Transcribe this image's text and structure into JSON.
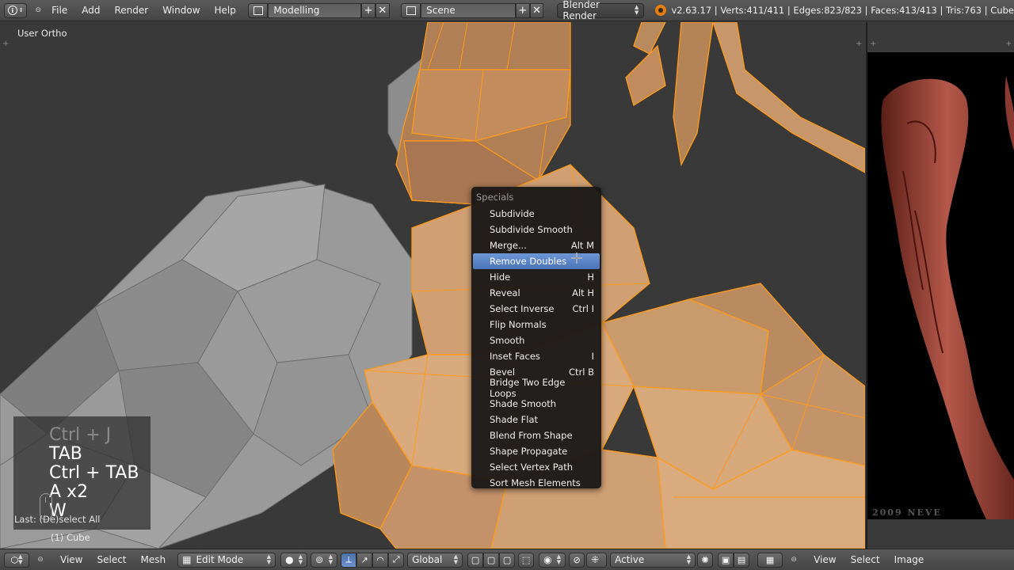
{
  "topbar": {
    "menus": [
      "File",
      "Add",
      "Render",
      "Window",
      "Help"
    ],
    "layout": "Modelling",
    "scene": "Scene",
    "engine": "Blender Render",
    "stats": "v2.63.17 | Verts:411/411 | Edges:823/823 | Faces:413/413 | Tris:763 | Cube"
  },
  "viewport": {
    "view_label": "User Ortho",
    "object_label": "(1) Cube",
    "last_op": "Last: (De)select All"
  },
  "key_overlay": {
    "keys": [
      "Ctrl + J",
      "TAB",
      "Ctrl + TAB",
      "A x2",
      "W"
    ]
  },
  "specials_menu": {
    "title": "Specials",
    "items": [
      {
        "label": "Subdivide",
        "shortcut": ""
      },
      {
        "label": "Subdivide Smooth",
        "shortcut": ""
      },
      {
        "label": "Merge...",
        "shortcut": "Alt M"
      },
      {
        "label": "Remove Doubles",
        "shortcut": ""
      },
      {
        "label": "Hide",
        "shortcut": "H"
      },
      {
        "label": "Reveal",
        "shortcut": "Alt H"
      },
      {
        "label": "Select Inverse",
        "shortcut": "Ctrl I"
      },
      {
        "label": "Flip Normals",
        "shortcut": ""
      },
      {
        "label": "Smooth",
        "shortcut": ""
      },
      {
        "label": "Inset Faces",
        "shortcut": "I"
      },
      {
        "label": "Bevel",
        "shortcut": "Ctrl B"
      },
      {
        "label": "Bridge Two Edge Loops",
        "shortcut": ""
      },
      {
        "label": "Shade Smooth",
        "shortcut": ""
      },
      {
        "label": "Shade Flat",
        "shortcut": ""
      },
      {
        "label": "Blend From Shape",
        "shortcut": ""
      },
      {
        "label": "Shape Propagate",
        "shortcut": ""
      },
      {
        "label": "Select Vertex Path",
        "shortcut": ""
      },
      {
        "label": "Sort Mesh Elements",
        "shortcut": ""
      }
    ],
    "active_item": "Remove Doubles"
  },
  "bottombar": {
    "menus": [
      "View",
      "Select",
      "Mesh"
    ],
    "mode": "Edit Mode",
    "orientation": "Global",
    "pivot": "Active",
    "right_menus": [
      "View",
      "Select",
      "Image"
    ]
  },
  "right_panel": {
    "caption": "2009    NEVE"
  },
  "colors": {
    "wire": "#ff9a1a",
    "mesh_face": "#c8976a",
    "menu_highlight": "#5a82c4",
    "header": "#4d4d4d"
  }
}
